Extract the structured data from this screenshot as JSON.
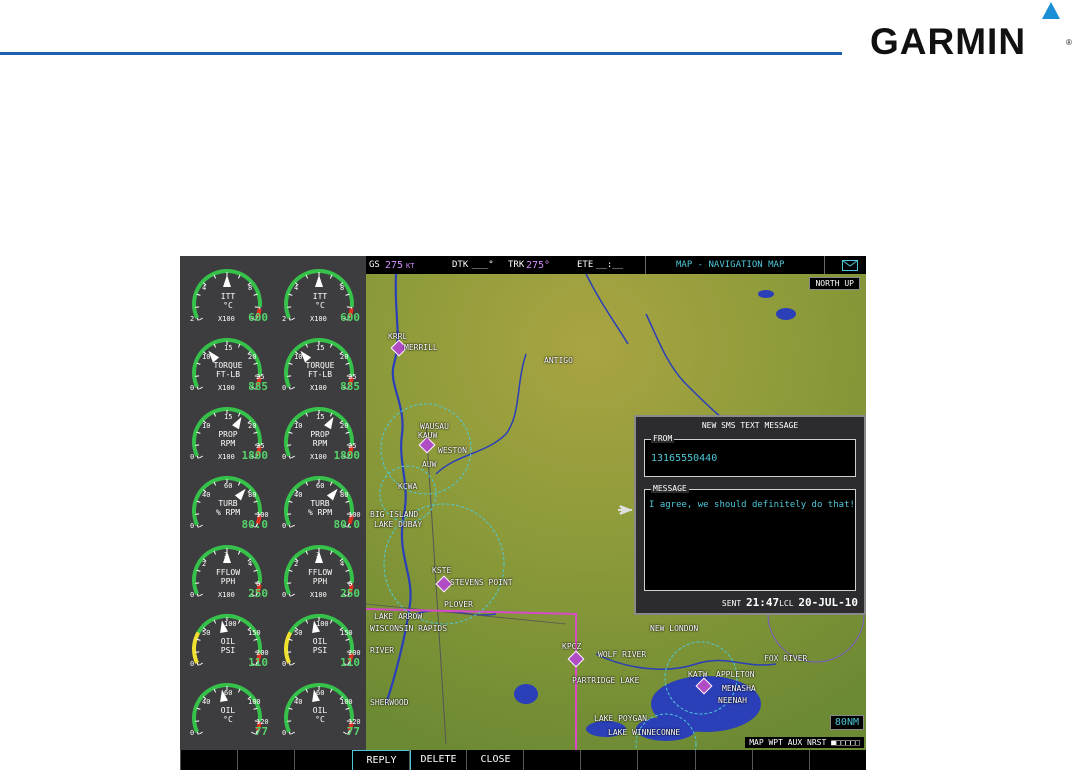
{
  "brand": {
    "logo_text": "GARMIN",
    "reg_mark": "®"
  },
  "topbar": {
    "gs_label": "GS",
    "gs_value": "275",
    "gs_unit": "KT",
    "dtk_label": "DTK",
    "dtk_value": "___°",
    "trk_label": "TRK",
    "trk_value": "275°",
    "ete_label": "ETE",
    "ete_value": "__:__",
    "page_title": "MAP - NAVIGATION MAP"
  },
  "gauges": [
    {
      "label1": "ITT",
      "label2": "°C",
      "scale": "X100",
      "value": "600",
      "t_left": "4",
      "t_mid": "",
      "t_right": "8",
      "t_bl": "2",
      "t_br": ""
    },
    {
      "label1": "ITT",
      "label2": "°C",
      "scale": "X100",
      "value": "600",
      "t_left": "4",
      "t_mid": "",
      "t_right": "8",
      "t_bl": "2",
      "t_br": ""
    },
    {
      "label1": "TORQUE",
      "label2": "FT-LB",
      "scale": "X100",
      "value": "885",
      "t_left": "10",
      "t_mid": "15",
      "t_right": "20",
      "t_bl": "0",
      "t_br": "25"
    },
    {
      "label1": "TORQUE",
      "label2": "FT-LB",
      "scale": "X100",
      "value": "885",
      "t_left": "10",
      "t_mid": "15",
      "t_right": "20",
      "t_bl": "0",
      "t_br": "25"
    },
    {
      "label1": "PROP",
      "label2": "RPM",
      "scale": "X100",
      "value": "1800",
      "t_left": "10",
      "t_mid": "15",
      "t_right": "20",
      "t_bl": "0",
      "t_br": "25"
    },
    {
      "label1": "PROP",
      "label2": "RPM",
      "scale": "X100",
      "value": "1800",
      "t_left": "10",
      "t_mid": "15",
      "t_right": "20",
      "t_bl": "0",
      "t_br": "25"
    },
    {
      "label1": "TURB",
      "label2": "% RPM",
      "scale": "",
      "value": "80.0",
      "t_left": "40",
      "t_mid": "60",
      "t_right": "80",
      "t_bl": "0",
      "t_br": "100"
    },
    {
      "label1": "TURB",
      "label2": "% RPM",
      "scale": "",
      "value": "80.0",
      "t_left": "40",
      "t_mid": "60",
      "t_right": "80",
      "t_bl": "0",
      "t_br": "100"
    },
    {
      "label1": "FFLOW",
      "label2": "PPH",
      "scale": "X100",
      "value": "250",
      "t_left": "2",
      "t_mid": "3",
      "t_right": "4",
      "t_bl": "0",
      "t_br": "6"
    },
    {
      "label1": "FFLOW",
      "label2": "PPH",
      "scale": "X100",
      "value": "250",
      "t_left": "2",
      "t_mid": "3",
      "t_right": "4",
      "t_bl": "0",
      "t_br": "6"
    },
    {
      "label1": "OIL",
      "label2": "PSI",
      "scale": "",
      "value": "110",
      "t_left": "50",
      "t_mid": "100",
      "t_right": "150",
      "t_bl": "0",
      "t_br": "200"
    },
    {
      "label1": "OIL",
      "label2": "PSI",
      "scale": "",
      "value": "110",
      "t_left": "50",
      "t_mid": "100",
      "t_right": "150",
      "t_bl": "0",
      "t_br": "200"
    },
    {
      "label1": "OIL",
      "label2": "°C",
      "scale": "",
      "value": "77",
      "t_left": "40",
      "t_mid": "60",
      "t_right": "100",
      "t_bl": "0",
      "t_br": "120"
    },
    {
      "label1": "OIL",
      "label2": "°C",
      "scale": "",
      "value": "77",
      "t_left": "40",
      "t_mid": "60",
      "t_right": "100",
      "t_bl": "0",
      "t_br": "120"
    }
  ],
  "map": {
    "orientation": "NORTH UP",
    "range": "80NM",
    "page_group": "MAP WPT AUX NRST",
    "labels": [
      "KRRL",
      "MERRILL",
      "ANTIGO",
      "WAUSAU",
      "KAUW",
      "WESTON",
      "AUW",
      "KCWA",
      "BIG ISLAND",
      "LAKE DUBAY",
      "KSTE",
      "STEVENS POINT",
      "PLOVER",
      "WISCONSIN RAPIDS",
      "KPCZ",
      "WOLF RIVER",
      "NEW LONDON",
      "PARTRIDGE LAKE",
      "APPLETON",
      "KATW",
      "MENASHA",
      "NEENAH",
      "LAKE POYGAN",
      "LAKE WINNECONNE",
      "FOX RIVER",
      "SHERWOOD",
      "LAKE ARROW",
      "RIVER"
    ]
  },
  "sms": {
    "title": "NEW SMS TEXT MESSAGE",
    "from_label": "FROM",
    "from_value": "13165550440",
    "message_label": "MESSAGE",
    "message_text": "I agree, we should definitely do that!",
    "sent_label": "SENT",
    "sent_time": "21:47",
    "sent_tz": "LCL",
    "sent_date": "20-JUL-10"
  },
  "softkeys": [
    "",
    "",
    "",
    "REPLY",
    "DELETE",
    "CLOSE",
    "",
    "",
    "",
    "",
    "",
    ""
  ],
  "colors": {
    "accent_cyan": "#4ec8d8",
    "value_green": "#56d36b",
    "magenta": "#d88cff",
    "garmin_blue": "#1b8fd6"
  }
}
